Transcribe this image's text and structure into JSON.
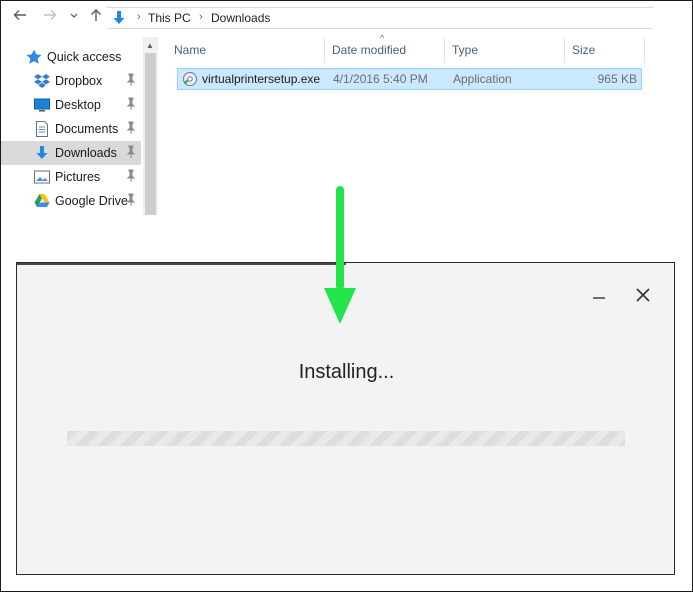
{
  "explorer": {
    "breadcrumb": [
      "This PC",
      "Downloads"
    ],
    "sidebar": [
      {
        "label": "Quick access",
        "icon": "star-icon",
        "pinned": false,
        "selected": false
      },
      {
        "label": "Dropbox",
        "icon": "dropbox-icon",
        "pinned": true,
        "selected": false
      },
      {
        "label": "Desktop",
        "icon": "desktop-icon",
        "pinned": true,
        "selected": false
      },
      {
        "label": "Documents",
        "icon": "documents-icon",
        "pinned": true,
        "selected": false
      },
      {
        "label": "Downloads",
        "icon": "downloads-icon",
        "pinned": true,
        "selected": true
      },
      {
        "label": "Pictures",
        "icon": "pictures-icon",
        "pinned": true,
        "selected": false
      },
      {
        "label": "Google Drive",
        "icon": "google-drive-icon",
        "pinned": true,
        "selected": false
      }
    ],
    "columns": [
      "Name",
      "Date modified",
      "Type",
      "Size"
    ],
    "sort_column": "Date modified",
    "files": [
      {
        "name": "virtualprintersetup.exe",
        "date_modified": "4/1/2016 5:40 PM",
        "type": "Application",
        "size": "965 KB",
        "selected": true
      }
    ]
  },
  "installer": {
    "status_text": "Installing...",
    "progress_percent": 0
  },
  "colors": {
    "arrow": "#22e34a",
    "selection": "#cce8ff",
    "selection_border": "#99d1ff",
    "column_header_text": "#4c607a",
    "folder_blue": "#1e88e5"
  }
}
